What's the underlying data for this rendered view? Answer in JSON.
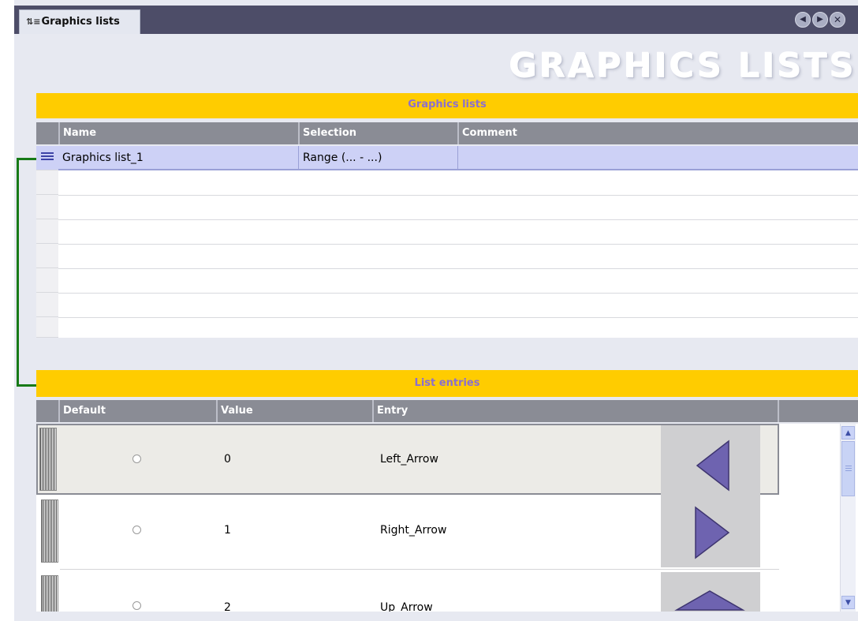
{
  "tab": {
    "icon": "list-sort-icon",
    "label": "Graphics lists"
  },
  "nav": {
    "back_icon": "nav-back-icon",
    "forward_icon": "nav-forward-icon",
    "close_icon": "close-icon"
  },
  "page_title": "GRAPHICS LISTS",
  "graphics_lists": {
    "header": "Graphics lists",
    "columns": [
      "Name",
      "Selection",
      "Comment"
    ],
    "rows": [
      {
        "name": "Graphics list_1",
        "selection": "Range (... - ...)",
        "comment": ""
      }
    ]
  },
  "list_entries": {
    "header": "List entries",
    "columns": [
      "Default",
      "Value",
      "Entry"
    ],
    "rows": [
      {
        "default": false,
        "value": "0",
        "entry": "Left_Arrow",
        "graphic": "left-arrow-icon",
        "selected": true
      },
      {
        "default": false,
        "value": "1",
        "entry": "Right_Arrow",
        "graphic": "right-arrow-icon",
        "selected": false
      },
      {
        "default": false,
        "value": "2",
        "entry": "Up_Arrow",
        "graphic": "up-arrow-icon",
        "selected": false
      }
    ]
  },
  "colors": {
    "section_header_bg": "#ffcc00",
    "section_header_text": "#8a6fd0",
    "selected_row": "#cdd1f6",
    "connector": "#177a17",
    "arrow_fill": "#6e63b0"
  }
}
